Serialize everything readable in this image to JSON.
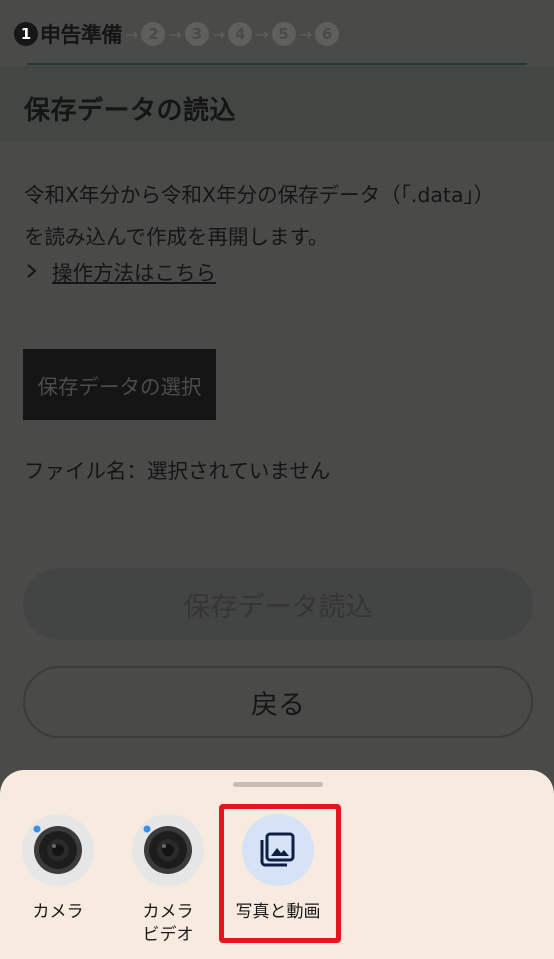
{
  "progress": {
    "steps": [
      {
        "num": "1",
        "label": "申告準備"
      },
      {
        "num": "2"
      },
      {
        "num": "3"
      },
      {
        "num": "4"
      },
      {
        "num": "5"
      },
      {
        "num": "6"
      }
    ],
    "arrow": "→"
  },
  "page": {
    "title": "保存データの読込",
    "description_line1": "令和X年分から令和X年分の保存データ（「.data」）",
    "description_line2": "を読み込んで作成を再開します。",
    "help_link": "操作方法はこちら",
    "select_button": "保存データの選択",
    "filename_text": "ファイル名：選択されていません",
    "load_button": "保存データ読込",
    "back_button": "戻る"
  },
  "sheet": {
    "apps": [
      {
        "label": "カメラ",
        "icon": "camera-icon"
      },
      {
        "label_line1": "カメラ",
        "label_line2": "ビデオ",
        "icon": "camera-icon"
      },
      {
        "label": "写真と動画",
        "icon": "photo-library-icon"
      }
    ]
  },
  "colors": {
    "overlay_dim": "#4a4b49",
    "sheet_bg": "#f7ebe0",
    "highlight": "#e8141d",
    "photos_icon_bg": "#d6e3f7"
  }
}
